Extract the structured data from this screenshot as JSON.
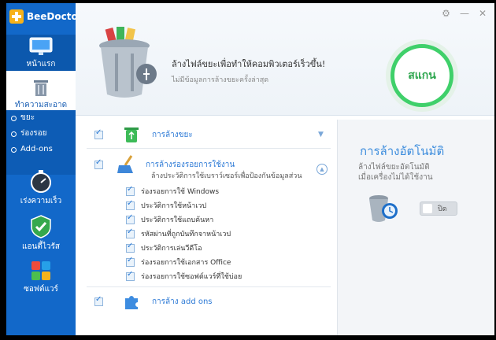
{
  "app": {
    "title": "BeeDoctor"
  },
  "sidebar": {
    "home": "หน้าแรก",
    "clean": "ทำความสะอาด",
    "sub_items": [
      "ขยะ",
      "ร่องรอย",
      "Add-ons"
    ],
    "speed": "เร่งความเร็ว",
    "antivirus": "แอนตี้ไวรัส",
    "software": "ซอฟต์แวร์"
  },
  "header": {
    "title": "ล้างไฟล์ขยะเพื่อทำให้คอมพิวเตอร์เร็วขึ้น!",
    "subtitle": "ไม่มีข้อมูลการล้างขยะครั้งล่าสุด",
    "scan_label": "สแกน"
  },
  "list": {
    "junk": "การล้างขยะ",
    "traces": "การล้างร่องรอยการใช้งาน",
    "traces_desc": "ล้างประวัติการใช้เบราว์เซอร์เพื่อป้องกันข้อมูลส่วน",
    "trace_items": [
      "ร่องรอยการใช้ Windows",
      "ประวัติการใช้หน้าเวป",
      "ประวัติการใช้แถบค้นหา",
      "รหัสผ่านที่ถูกบันทึกจาหน้าเวป",
      "ประวัติการเล่นวีดีโอ",
      "ร่องรอยการใช้เอกสาร Office",
      "ร่องรอยการใช้ซอฟต์แวร์ที่ใช้บ่อย"
    ],
    "addons": "การล้าง add ons"
  },
  "auto": {
    "title": "การล้างอัตโนมัติ",
    "desc_line1": "ล้างไฟล์ขยะอัตโนมัติ",
    "desc_line2": "เมื่อเครื่องไม่ได้ใช้งาน",
    "toggle_label": "ปิด"
  },
  "colors": {
    "sidebar": "#1268c9",
    "accent": "#2d7ad6",
    "scan": "#3fd06a"
  },
  "icons": [
    "settings-icon",
    "minimize-icon",
    "close-icon",
    "monitor-icon",
    "trash-icon",
    "stopwatch-icon",
    "shield-icon",
    "apps-icon",
    "recycle-icon",
    "broom-icon",
    "puzzle-icon"
  ]
}
